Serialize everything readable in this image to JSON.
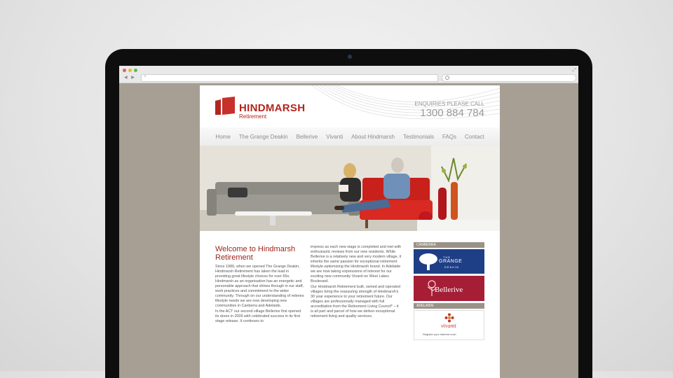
{
  "site": {
    "logo_name": "HINDMARSH",
    "logo_sub": "Retirement",
    "enquiries_label": "ENQUIRIES PLEASE CALL",
    "phone": "1300 884 784"
  },
  "nav": [
    "Home",
    "The Grange Deakin",
    "Bellerive",
    "Vivanti",
    "About Hindmarsh",
    "Testimonials",
    "FAQs",
    "Contact"
  ],
  "welcome": {
    "heading": "Welcome to Hindmarsh Retirement",
    "p1": "Since 1989, when we opened The Grange Deakin, Hindmarsh Retirement has taken the lead in providing great lifestyle choices for over-55s. Hindmarsh as an organisation has an energetic and personable approach that shines through in our staff, work practices and commitment to the wider community. Through on our understanding of retirees lifestyle needs we are now developing new communities in Canberra and Adelaide.",
    "p2": "In the ACT our second village Bellerive first opened its doors in 2009 with celebrated success in its first stage release. It continues to",
    "p3": "impress as each new stage is completed and met with enthusiastic reviews from our new residents. While Bellerive is a relatively new and very modern village, it inherits the same passion for exceptional retirement lifestyle epitomising the Hindmarsh brand. In Adelaide we are now taking expressions of interest for our exciting new community Vivanti on West Lakes Boulevard.",
    "p4": "Our Hindmarsh Retirement built, owned and operated villages bring the reassuring strength of Hindmarsh's 30 year experience to your retirement future. Our villages are professionally managed with full accreditation from the Retirement Living Council* – it is all part and parcel of how we deliver exceptional retirement living and quality services."
  },
  "sidebar": {
    "canberra_label": "CANBERRA",
    "grange": {
      "l1": "THE",
      "l2": "GRANGE",
      "l3": "DEAKIN"
    },
    "bellerive": "Bellerive",
    "adelaide_label": "ADELAIDE",
    "vivanti": "vivanti",
    "vivanti_sub": "Register your interest now!"
  },
  "colors": {
    "brand_red": "#b3261e",
    "screen_bg": "#a79f93",
    "grange_blue": "#1e3f86",
    "bellerive_red": "#a51e36"
  }
}
